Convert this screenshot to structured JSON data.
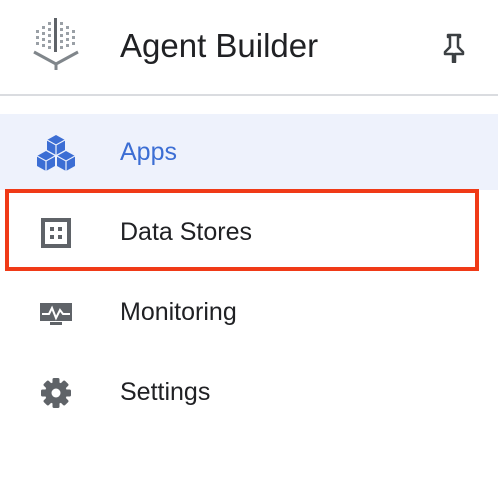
{
  "header": {
    "logo_icon": "agent-builder-logo-icon",
    "title": "Agent Builder",
    "pin_icon": "pin-icon"
  },
  "nav": {
    "items": [
      {
        "label": "Apps",
        "icon": "cubes-icon",
        "active": true
      },
      {
        "label": "Data Stores",
        "icon": "data-grid-icon",
        "active": false,
        "highlighted": true
      },
      {
        "label": "Monitoring",
        "icon": "monitor-icon",
        "active": false
      },
      {
        "label": "Settings",
        "icon": "gear-icon",
        "active": false
      }
    ]
  },
  "colors": {
    "active_text": "#3c6ed4",
    "active_background": "#eef2fc",
    "highlight_border": "#f03a17",
    "icon_gray": "#5f6368"
  }
}
